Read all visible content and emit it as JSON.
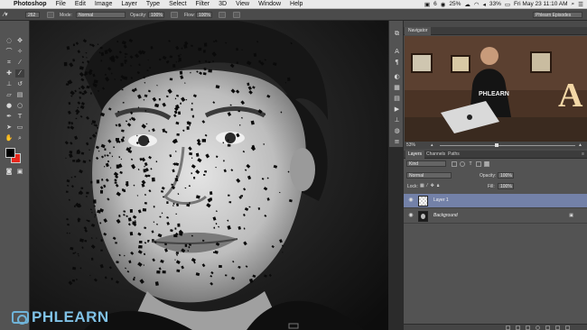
{
  "menubar": {
    "apple": "",
    "app_name": "Photoshop",
    "menus": [
      "File",
      "Edit",
      "Image",
      "Layer",
      "Type",
      "Select",
      "Filter",
      "3D",
      "View",
      "Window",
      "Help"
    ],
    "status_num": "6",
    "battery_pct": "25%",
    "volume_pct": "33%",
    "clock": "Fri May 23  11:10 AM"
  },
  "options_bar": {
    "brush_size": "262",
    "mode_label": "Mode:",
    "mode_value": "Normal",
    "opacity_label": "Opacity:",
    "opacity_value": "100%",
    "flow_label": "Flow:",
    "flow_value": "100%",
    "workspace": "Phlearn Episodes"
  },
  "toolbar": {
    "tools": [
      "marquee-icon",
      "move-icon",
      "lasso-icon",
      "magic-wand-icon",
      "crop-icon",
      "eyedropper-icon",
      "healing-icon",
      "brush-icon",
      "clone-stamp-icon",
      "history-brush-icon",
      "eraser-icon",
      "gradient-icon",
      "blur-icon",
      "dodge-icon",
      "pen-icon",
      "type-icon",
      "path-select-icon",
      "shape-icon",
      "hand-icon",
      "zoom-icon"
    ],
    "foreground_color": "#000000",
    "background_color": "#e8271c"
  },
  "navigator": {
    "tab": "Navigator",
    "zoom": "53%",
    "preview_text": "PHLEARN"
  },
  "layers_panel": {
    "tabs": [
      "Layers",
      "Channels",
      "Paths"
    ],
    "kind_label": "Kind",
    "blend_mode": "Normal",
    "opacity_label": "Opacity:",
    "opacity_value": "100%",
    "lock_label": "Lock:",
    "fill_label": "Fill:",
    "fill_value": "100%",
    "layers": [
      {
        "name": "Layer 1",
        "selected": true
      },
      {
        "name": "Background",
        "selected": false
      }
    ]
  },
  "watermark": "PHLEARN",
  "colors": {
    "accent": "#7381a8",
    "watermark": "#7fc1e6"
  }
}
